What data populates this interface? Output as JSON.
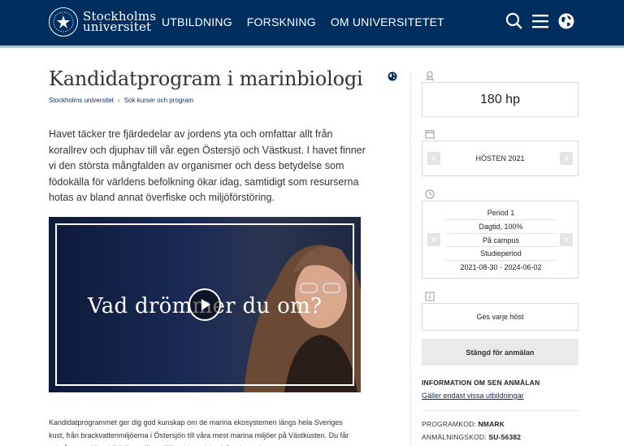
{
  "header": {
    "logo_line1": "Stockholms",
    "logo_line2": "universitet",
    "nav": [
      "UTBILDNING",
      "FORSKNING",
      "OM UNIVERSITETET"
    ],
    "icons": [
      "search-icon",
      "menu-icon",
      "globe-icon"
    ]
  },
  "page": {
    "title": "Kandidatprogram i marinbiologi",
    "breadcrumb": [
      "Stockholms universitet",
      "Sök kurser och program"
    ],
    "intro": "Havet täcker tre fjärdedelar av jordens yta och omfattar allt från korallrev och djuphav till vår egen Östersjö och Västkust. I havet finner vi den största mångfalden av organismer och dess betydelse som födokälla för världens befolkning ökar idag, samtidigt som resurserna hotas av bland annat överfiske och miljöförstöring.",
    "video_caption": "Vad drömmer du om?",
    "body_text": "Kandidatprogrammet ger dig god kunskap om de marina ekosystemen längs hela Sveriges kust, från brackvattenmiljöerna i Östersjön till våra mest marina miljöer på Västkusten. Du får också en god överblick över vilka miljöproblem vi har i Sverige och"
  },
  "sidebar": {
    "credits": "180 hp",
    "term": "HÖSTEN 2021",
    "period": [
      "Period 1",
      "Dagtid, 100%",
      "På campus",
      "Studieperiod",
      "2021-08-30 - 2024-06-02"
    ],
    "admission": "Ges varje höst",
    "closed_label": "Stängd för anmälan",
    "info_head": "INFORMATION OM SEN ANMÄLAN",
    "info_link": "Gäller endast vissa utbildningar",
    "program_code_label": "PROGRAMKOD:",
    "program_code": "NMARK",
    "application_code_label": "ANMÄLNINGSKOD:",
    "application_code": "SU-56382"
  },
  "colors": {
    "brand": "#002f5f",
    "closed_bg": "#eaeaea"
  }
}
